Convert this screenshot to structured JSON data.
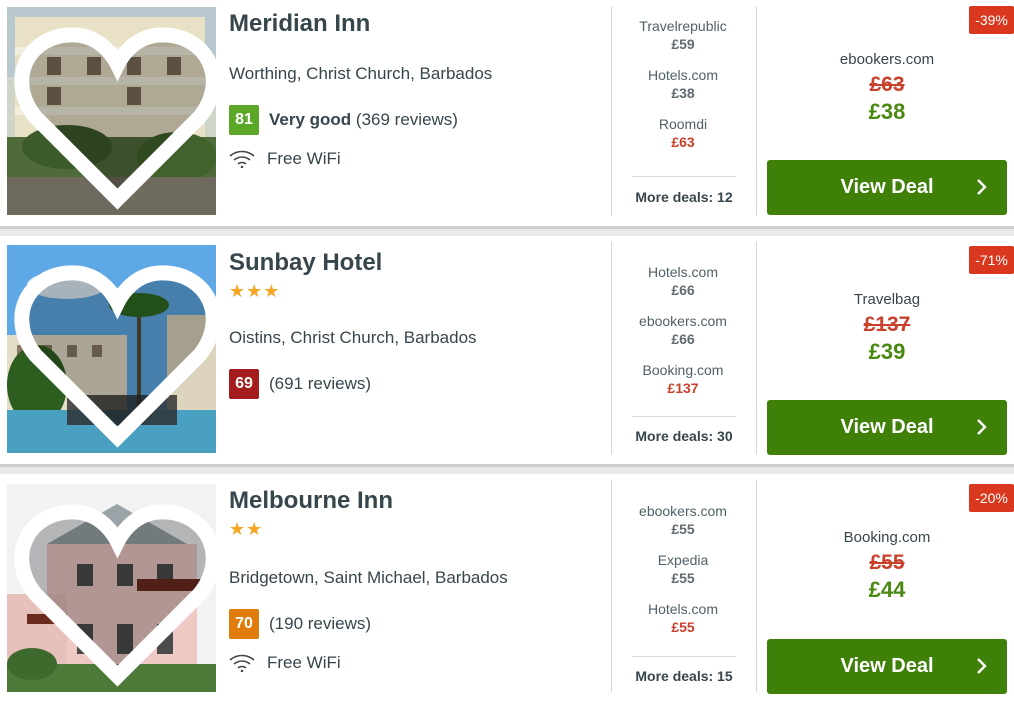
{
  "hotels": [
    {
      "name": "Meridian Inn",
      "stars": "",
      "location": "Worthing, Christ Church, Barbados",
      "rating": {
        "score": "81",
        "label": "Very good",
        "reviews": "(369 reviews)",
        "color": "#5ba728"
      },
      "amenity": "Free WiFi",
      "deals": [
        {
          "provider": "Travelrepublic",
          "price": "£59"
        },
        {
          "provider": "Hotels.com",
          "price": "£38"
        },
        {
          "provider": "Roomdi",
          "price": "£63"
        }
      ],
      "more_deals": "More deals: 12",
      "discount": "-39%",
      "best": {
        "provider": "ebookers.com",
        "old_price": "£63",
        "new_price": "£38"
      },
      "button_label": "View Deal"
    },
    {
      "name": "Sunbay Hotel",
      "stars": "★★★",
      "location": "Oistins, Christ Church, Barbados",
      "rating": {
        "score": "69",
        "label": "",
        "reviews": "(691 reviews)",
        "color": "#a51c1c"
      },
      "amenity": "",
      "deals": [
        {
          "provider": "Hotels.com",
          "price": "£66"
        },
        {
          "provider": "ebookers.com",
          "price": "£66"
        },
        {
          "provider": "Booking.com",
          "price": "£137"
        }
      ],
      "more_deals": "More deals: 30",
      "discount": "-71%",
      "best": {
        "provider": "Travelbag",
        "old_price": "£137",
        "new_price": "£39"
      },
      "button_label": "View Deal"
    },
    {
      "name": "Melbourne Inn",
      "stars": "★★",
      "location": "Bridgetown, Saint Michael, Barbados",
      "rating": {
        "score": "70",
        "label": "",
        "reviews": "(190 reviews)",
        "color": "#e07c0b"
      },
      "amenity": "Free WiFi",
      "deals": [
        {
          "provider": "ebookers.com",
          "price": "£55"
        },
        {
          "provider": "Expedia",
          "price": "£55"
        },
        {
          "provider": "Hotels.com",
          "price": "£55"
        }
      ],
      "more_deals": "More deals: 15",
      "discount": "-20%",
      "best": {
        "provider": "Booking.com",
        "old_price": "£55",
        "new_price": "£44"
      },
      "button_label": "View Deal"
    }
  ]
}
